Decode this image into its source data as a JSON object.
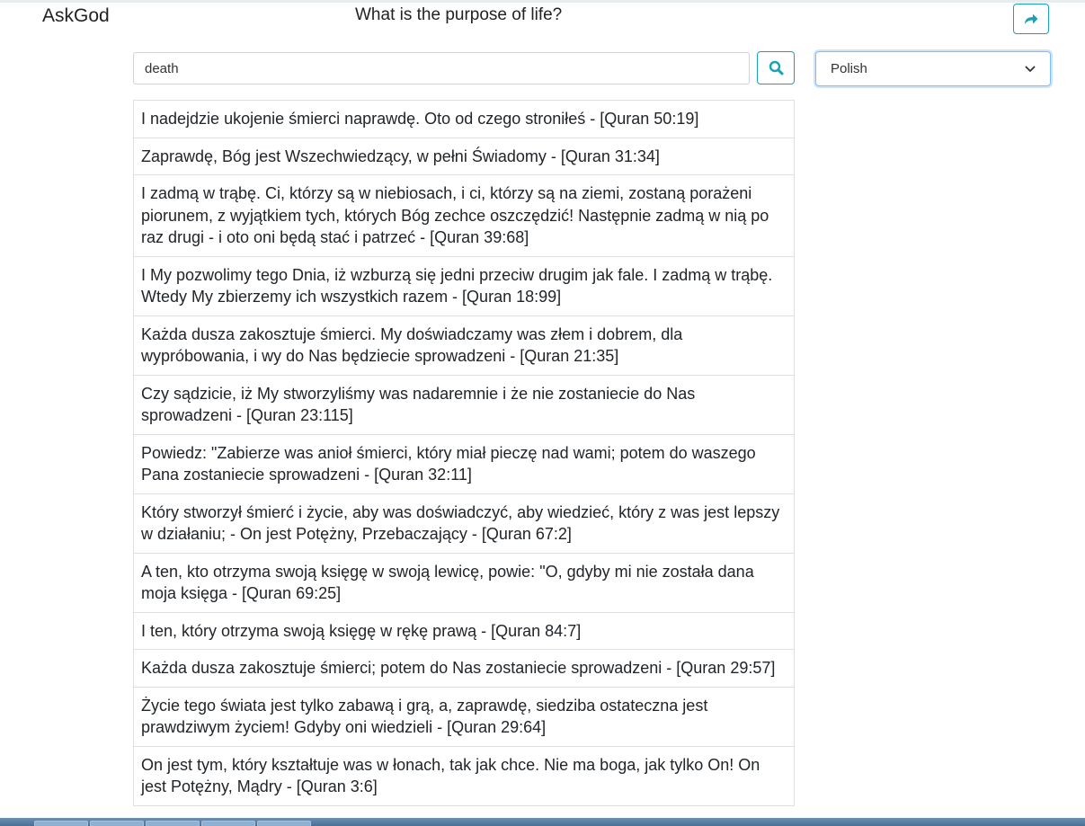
{
  "header": {
    "brand": "AskGod",
    "question": "What is the purpose of life?",
    "share_icon": "share-arrow-icon"
  },
  "search": {
    "value": "death",
    "button_icon": "search-icon"
  },
  "language": {
    "selected": "Polish",
    "icon": "chevron-down-icon"
  },
  "colors": {
    "accent": "#17a2b8",
    "select_focus": "#80bdff"
  },
  "results": [
    "I nadejdzie ukojenie śmierci naprawdę. Oto od czego stroniłeś - [Quran 50:19]",
    "Zaprawdę, Bóg jest Wszechwiedzący, w pełni Świadomy - [Quran 31:34]",
    "I zadmą w trąbę. Ci, którzy są w niebiosach, i ci, którzy są na ziemi, zostaną porażeni piorunem, z wyjątkiem tych, których Bóg zechce oszczędzić! Następnie zadmą w nią po raz drugi - i oto oni będą stać i patrzeć - [Quran 39:68]",
    "I My pozwolimy tego Dnia, iż wzburzą się jedni przeciw drugim jak fale. I zadmą w trąbę. Wtedy My zbierzemy ich wszystkich razem - [Quran 18:99]",
    "Każda dusza zakosztuje śmierci. My doświadczamy was złem i dobrem, dla wypróbowania, i wy do Nas będziecie sprowadzeni - [Quran 21:35]",
    "Czy sądzicie, iż My stworzyliśmy was nadaremnie i że nie zostaniecie do Nas sprowadzeni - [Quran 23:115]",
    "Powiedz: \"Zabierze was anioł śmierci, który miał pieczę nad wami; potem do waszego Pana zostaniecie sprowadzeni - [Quran 32:11]",
    "Który stworzył śmierć i życie, aby was doświadczyć, aby wiedzieć, który z was jest lepszy w działaniu; - On jest Potężny, Przebaczający - [Quran 67:2]",
    "A ten, kto otrzyma swoją księgę w swoją lewicę, powie: \"O, gdyby mi nie została dana moja księga - [Quran 69:25]",
    "I ten, który otrzyma swoją księgę w rękę prawą - [Quran 84:7]",
    "Każda dusza zakosztuje śmierci; potem do Nas zostaniecie sprowadzeni - [Quran 29:57]",
    "Życie tego świata jest tylko zabawą i grą, a, zaprawdę, siedziba ostateczna jest prawdziwym życiem! Gdyby oni wiedzieli - [Quran 29:64]",
    "On jest tym, który kształtuje was w łonach, tak jak chce. Nie ma boga, jak tylko On! On jest Potężny, Mądry - [Quran 3:6]"
  ]
}
